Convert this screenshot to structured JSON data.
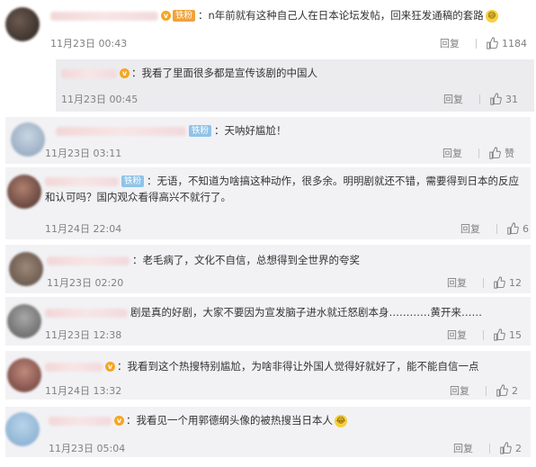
{
  "comments": [
    {
      "badge": "铁粉",
      "text": "n年前就有这种自己人在日本论坛发帖，回来狂发通稿的套路",
      "time": "11月23日 00:43",
      "reply_label": "回复",
      "likes": "1184",
      "sub_reply": {
        "text": "我看了里面很多都是宣传该剧的中国人",
        "time": "11月23日 00:45",
        "reply_label": "回复",
        "likes": "31"
      }
    },
    {
      "badge": "铁粉",
      "text": "天呐好尴尬！",
      "time": "11月23日 03:11",
      "reply_label": "回复",
      "likes": "赞"
    },
    {
      "badge": "铁粉",
      "text": "无语，不知道为啥搞这种动作，很多余。明明剧就还不错，需要得到日本的反应和认可吗？国内观众看得高兴不就行了。",
      "time": "11月24日 22:04",
      "reply_label": "回复",
      "likes": "6"
    },
    {
      "text": "老毛病了，文化不自信，总想得到全世界的夸奖",
      "time": "11月23日 02:20",
      "reply_label": "回复",
      "likes": "12"
    },
    {
      "text": "剧是真的好剧，大家不要因为宣发脑子进水就迁怒剧本身…………黄开来……",
      "time": "11月23日 12:38",
      "reply_label": "回复",
      "likes": "15"
    },
    {
      "text": "我看到这个热搜特别尴尬，为啥非得让外国人觉得好就好了，能不能自信一点",
      "time": "11月24日 13:32",
      "reply_label": "回复",
      "likes": "2"
    },
    {
      "text": "我看见一个用郭德纲头像的被热搜当日本人",
      "time": "11月23日 05:04",
      "reply_label": "回复",
      "likes": "2"
    }
  ],
  "colors": {
    "text": "#333333",
    "meta": "#808080",
    "badge_blue": "#8fc3e8",
    "badge_orange": "#f0a23c"
  },
  "icons": {
    "like": "thumbs-up-icon",
    "vip": "vip-badge-icon",
    "emoji_sweat": "sweat-smile-emoji",
    "emoji_laugh": "laugh-cry-emoji"
  }
}
